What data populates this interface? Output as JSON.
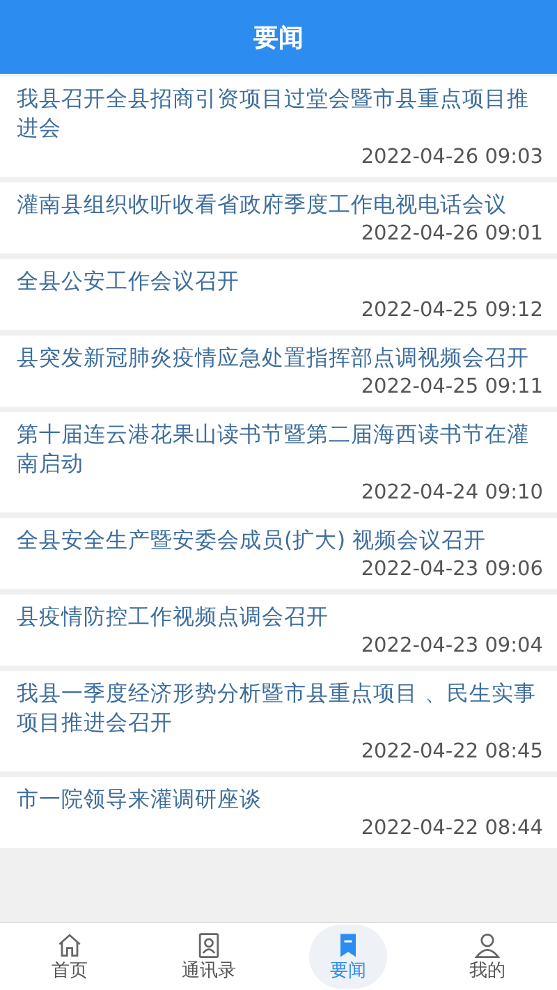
{
  "header": {
    "title": "要闻"
  },
  "news": [
    {
      "title": "我县召开全县招商引资项目过堂会暨市县重点项目推进会",
      "date": "2022-04-26 09:03"
    },
    {
      "title": "灌南县组织收听收看省政府季度工作电视电话会议",
      "date": "2022-04-26 09:01"
    },
    {
      "title": "全县公安工作会议召开",
      "date": "2022-04-25 09:12"
    },
    {
      "title": "县突发新冠肺炎疫情应急处置指挥部点调视频会召开",
      "date": "2022-04-25 09:11"
    },
    {
      "title": "第十届连云港花果山读书节暨第二届海西读书节在灌南启动",
      "date": "2022-04-24 09:10"
    },
    {
      "title": "全县安全生产暨安委会成员(扩大) 视频会议召开",
      "date": "2022-04-23 09:06"
    },
    {
      "title": "县疫情防控工作视频点调会召开",
      "date": "2022-04-23 09:04"
    },
    {
      "title": "我县一季度经济形势分析暨市县重点项目 、民生实事项目推进会召开",
      "date": "2022-04-22 08:45"
    },
    {
      "title": "市一院领导来灌调研座谈",
      "date": "2022-04-22 08:44"
    }
  ],
  "tabs": [
    {
      "kind": "home",
      "label": "首页",
      "selected": false
    },
    {
      "kind": "contacts",
      "label": "通讯录",
      "selected": false
    },
    {
      "kind": "news",
      "label": "要闻",
      "selected": true
    },
    {
      "kind": "profile",
      "label": "我的",
      "selected": false
    }
  ]
}
